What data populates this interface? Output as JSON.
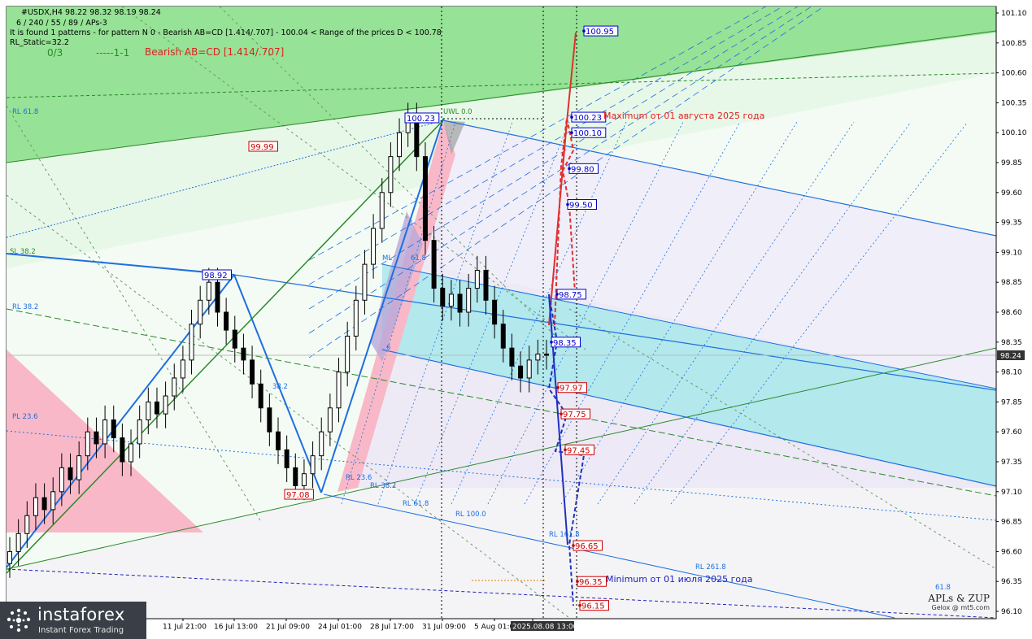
{
  "header": {
    "line1": "#USDX,H4  98.22 98.32 98.19 98.24",
    "line2": "6 / 240 / 55 / 89 / APs-3",
    "line3": "It is found 1 patterns  -  for pattern N 0 - Bearish AB=CD [1.414/.707] - 100.04 < Range of the prices D < 100.78",
    "line4": "RL_Static=32.2",
    "counter": "0/3",
    "ratio": "-----1-1",
    "pattern": "Bearish AB=CD [1.414/.707]"
  },
  "annotations": {
    "maximum": "Maximum от 01 августа 2025 года",
    "minimum": "Minimum от 01 июля 2025 года"
  },
  "footer": {
    "brand": "instaforex",
    "tagline": "Instant Forex Trading",
    "credit1": "APLs & ZUP",
    "credit2": "Gelox @ mt5.com"
  },
  "colors": {
    "green_zone": "#90e090",
    "cyan_zone": "#b0e8ec",
    "pink_zone": "#f8b8c8",
    "lavender_zone": "#ece8f6",
    "blue_line": "#1e6fe0",
    "red_line": "#e03030",
    "dark_blue_line": "#2030c0",
    "green_line": "#2a8a2a",
    "candle": "#000000"
  },
  "chart_data": {
    "type": "candlestick",
    "symbol": "#USDX,H4",
    "current_price": 98.24,
    "ylim": [
      96.1,
      101.1
    ],
    "y_ticks": [
      101.1,
      100.85,
      100.6,
      100.35,
      100.1,
      99.85,
      99.6,
      99.35,
      99.1,
      98.85,
      98.6,
      98.35,
      98.1,
      97.85,
      97.6,
      97.35,
      97.1,
      96.85,
      96.6,
      96.35,
      96.1
    ],
    "x_tick_labels": [
      "11 Jul 21:00",
      "16 Jul 13:00",
      "21 Jul 09:00",
      "24 Jul 01:00",
      "28 Jul 17:00",
      "31 Jul 09:00",
      "5 Aug 01:00",
      "2025.08.08 13:00"
    ],
    "price_level_labels": [
      {
        "value": 100.95,
        "label": "100.95",
        "color": "blue"
      },
      {
        "value": 100.23,
        "label": "100.23",
        "color": "blue"
      },
      {
        "value": 100.1,
        "label": "100.10",
        "color": "blue"
      },
      {
        "value": 99.8,
        "label": "99.80",
        "color": "blue"
      },
      {
        "value": 99.5,
        "label": "99.50",
        "color": "blue"
      },
      {
        "value": 98.75,
        "label": "98.75",
        "color": "blue"
      },
      {
        "value": 98.35,
        "label": "98.35",
        "color": "blue"
      },
      {
        "value": 97.97,
        "label": "97.97",
        "color": "red"
      },
      {
        "value": 97.75,
        "label": "97.75",
        "color": "red"
      },
      {
        "value": 97.45,
        "label": "97.45",
        "color": "red"
      },
      {
        "value": 96.65,
        "label": "96.65",
        "color": "red"
      },
      {
        "value": 96.35,
        "label": "96.35",
        "color": "red"
      },
      {
        "value": 96.15,
        "label": "96.15",
        "color": "red"
      }
    ],
    "pivot_labels": [
      {
        "value": 98.92,
        "label": "98.92"
      },
      {
        "value": 100.23,
        "label": "100.23"
      },
      {
        "value": 97.08,
        "label": "97.08"
      },
      {
        "value": 99.99,
        "label": "99.99"
      }
    ],
    "line_labels": [
      "UWL 0.0",
      "SL 38.2",
      "RL 61.8",
      "RL 38.2",
      "PL 23.6",
      "RL 23.6",
      "RL 38.2",
      "RL 61.8",
      "RL 100.0",
      "RL 161.8",
      "RL 261.8",
      "ML",
      "38.2",
      "61.8",
      "6",
      "61.8"
    ],
    "closes": [
      96.6,
      96.75,
      96.9,
      97.05,
      96.95,
      97.1,
      97.3,
      97.2,
      97.4,
      97.6,
      97.5,
      97.7,
      97.55,
      97.35,
      97.5,
      97.7,
      97.85,
      97.75,
      97.9,
      98.05,
      98.2,
      98.5,
      98.7,
      98.85,
      98.6,
      98.45,
      98.3,
      98.2,
      98.0,
      97.8,
      97.6,
      97.45,
      97.3,
      97.15,
      97.25,
      97.4,
      97.6,
      97.8,
      98.1,
      98.4,
      98.7,
      99.0,
      99.3,
      99.6,
      99.9,
      100.1,
      100.23,
      99.9,
      99.2,
      98.8,
      98.65,
      98.75,
      98.6,
      98.8,
      98.95,
      98.7,
      98.5,
      98.3,
      98.15,
      98.05,
      98.2,
      98.25,
      98.24
    ]
  }
}
